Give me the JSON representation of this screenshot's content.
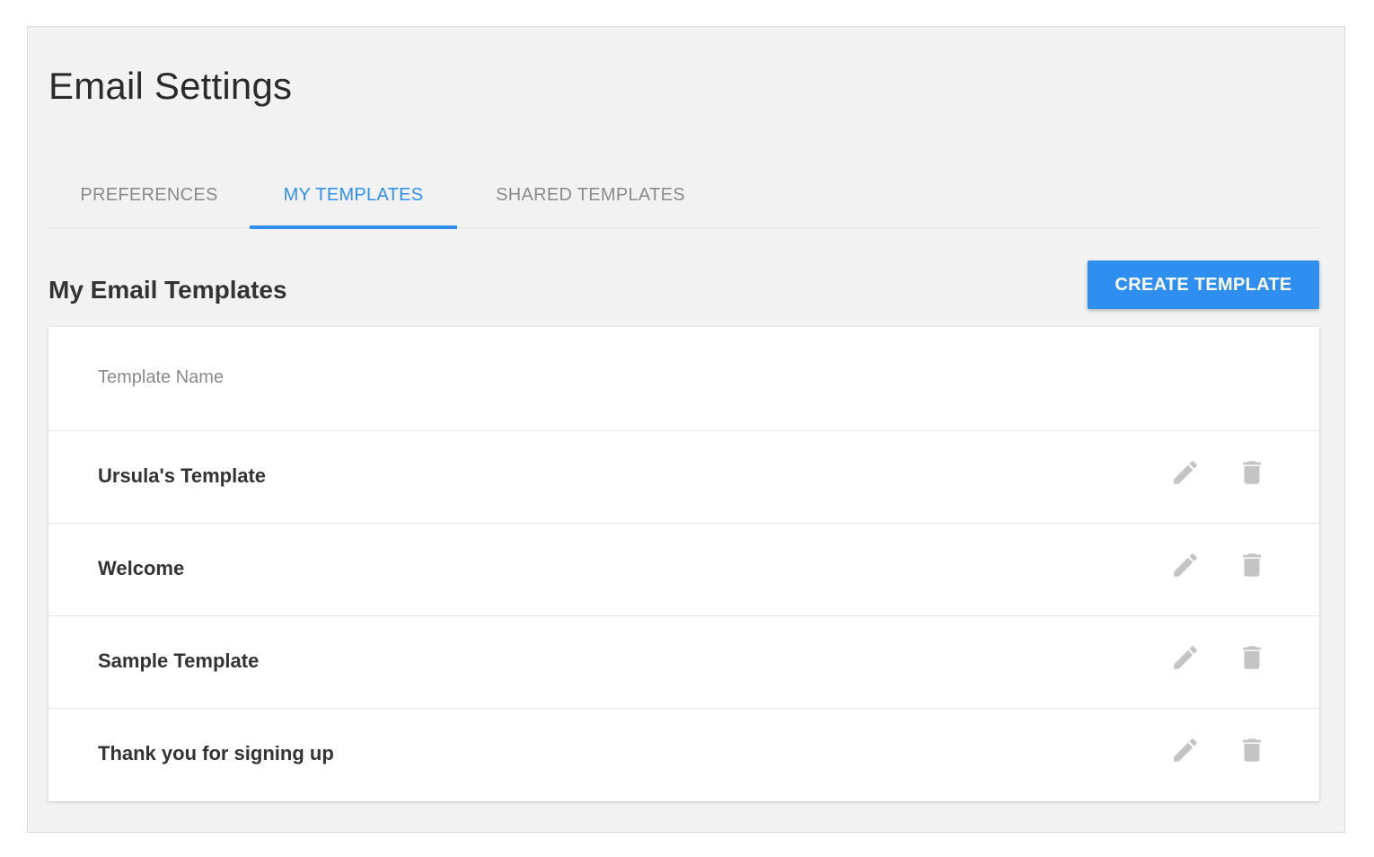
{
  "page": {
    "title": "Email Settings"
  },
  "tabs": [
    {
      "label": "PREFERENCES",
      "active": false
    },
    {
      "label": "MY TEMPLATES",
      "active": true
    },
    {
      "label": "SHARED TEMPLATES",
      "active": false
    }
  ],
  "section": {
    "title": "My Email Templates",
    "create_button_label": "CREATE TEMPLATE"
  },
  "table": {
    "column_header": "Template Name",
    "rows": [
      {
        "name": "Ursula's Template",
        "actions": [
          "pencil-icon",
          "trash-icon"
        ]
      },
      {
        "name": "Welcome",
        "actions": [
          "pencil-icon",
          "trash-icon"
        ]
      },
      {
        "name": "Sample Template",
        "actions": [
          "pencil-icon",
          "trash-icon"
        ]
      },
      {
        "name": "Thank you for signing up",
        "actions": [
          "pencil-icon",
          "trash-icon"
        ]
      }
    ]
  },
  "colors": {
    "accent": "#2f8ff0",
    "panel_background": "#f2f2f2",
    "icon_gray": "#c4c4c4"
  }
}
